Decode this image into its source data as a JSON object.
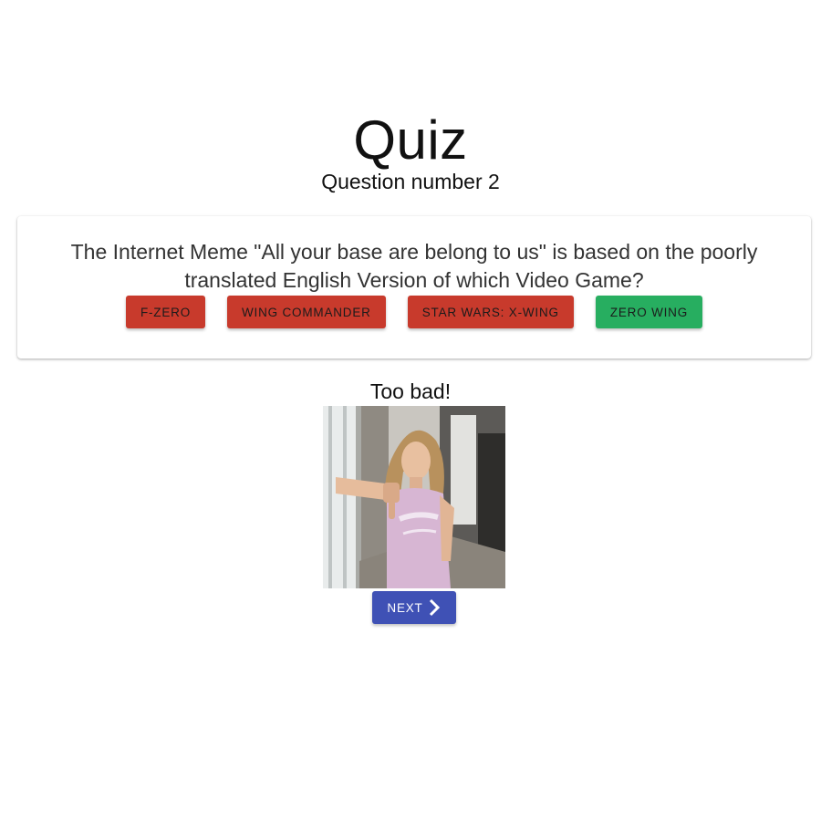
{
  "header": {
    "title": "Quiz",
    "subtitle": "Question number 2"
  },
  "question": {
    "text": "The Internet Meme \"All your base are belong to us\" is based on the poorly translated English Version of which Video Game?",
    "answers": [
      {
        "label": "F-ZERO",
        "status": "wrong"
      },
      {
        "label": "WING COMMANDER",
        "status": "wrong"
      },
      {
        "label": "STAR WARS: X-WING",
        "status": "wrong"
      },
      {
        "label": "ZERO WING",
        "status": "correct"
      }
    ]
  },
  "result": {
    "message": "Too bad!",
    "image": "thumbs-down-gif"
  },
  "next_button": {
    "label": "NEXT",
    "icon": "chevron-right-icon"
  },
  "colors": {
    "wrong": "#c83a2c",
    "correct": "#27ae60",
    "primary": "#3f51b5"
  }
}
